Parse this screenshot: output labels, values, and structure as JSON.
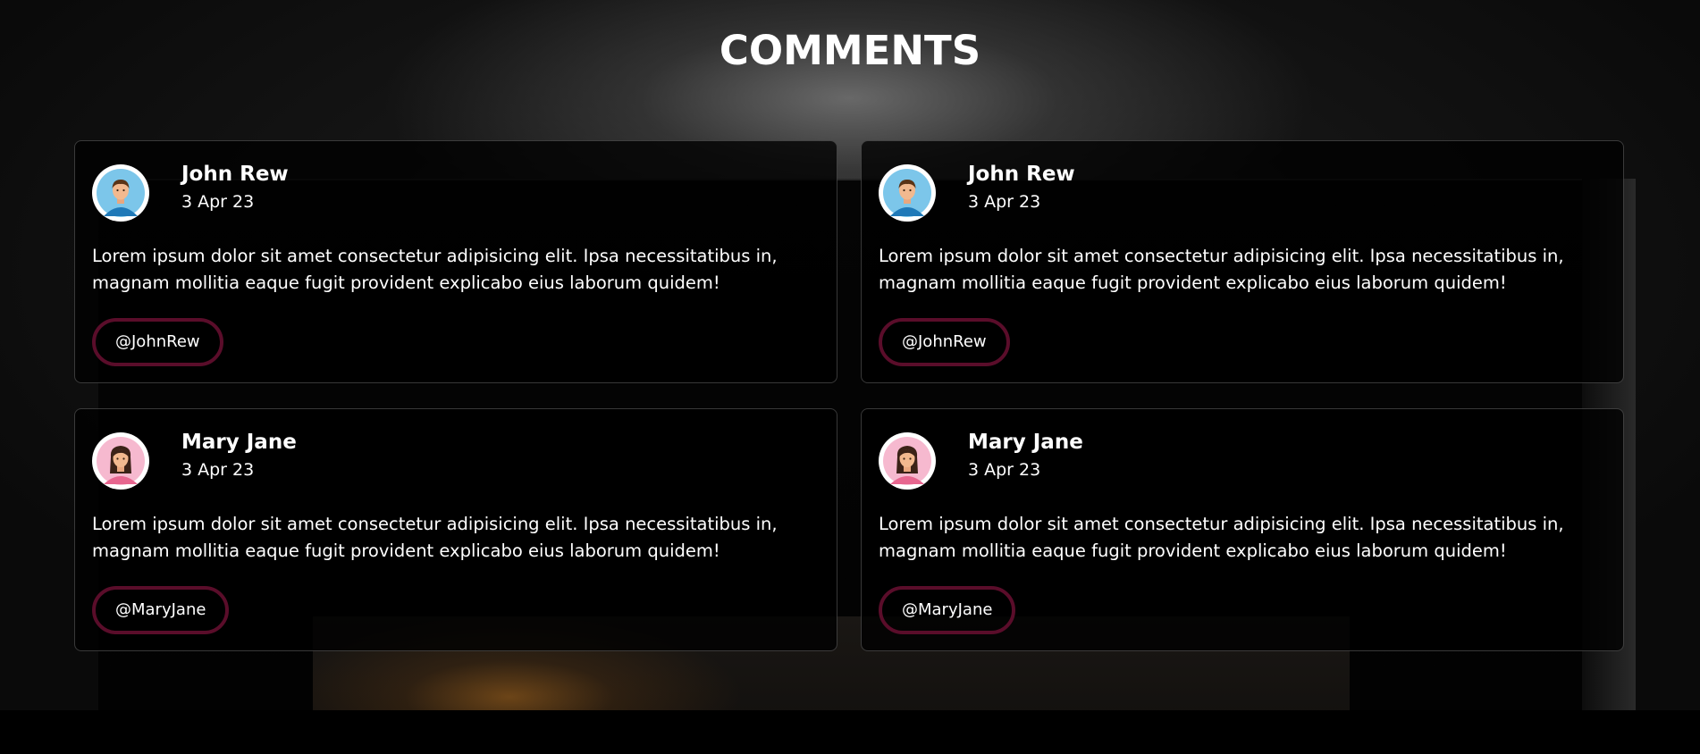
{
  "section": {
    "title": "COMMENTS"
  },
  "comments": [
    {
      "name": "John Rew",
      "date": "3 Apr 23",
      "text": "Lorem ipsum dolor sit amet consectetur adipisicing elit. Ipsa necessitatibus in, magnam mollitia eaque fugit provident explicabo eius laborum quidem!",
      "handle": "@JohnRew",
      "avatar": "male-user-avatar-icon"
    },
    {
      "name": "John Rew",
      "date": "3 Apr 23",
      "text": "Lorem ipsum dolor sit amet consectetur adipisicing elit. Ipsa necessitatibus in, magnam mollitia eaque fugit provident explicabo eius laborum quidem!",
      "handle": "@JohnRew",
      "avatar": "male-user-avatar-icon"
    },
    {
      "name": "Mary Jane",
      "date": "3 Apr 23",
      "text": "Lorem ipsum dolor sit amet consectetur adipisicing elit. Ipsa necessitatibus in, magnam mollitia eaque fugit provident explicabo eius laborum quidem!",
      "handle": "@MaryJane",
      "avatar": "female-user-avatar-icon"
    },
    {
      "name": "Mary Jane",
      "date": "3 Apr 23",
      "text": "Lorem ipsum dolor sit amet consectetur adipisicing elit. Ipsa necessitatibus in, magnam mollitia eaque fugit provident explicabo eius laborum quidem!",
      "handle": "@MaryJane",
      "avatar": "female-user-avatar-icon"
    }
  ],
  "colors": {
    "handle_border": "#5a0d2a",
    "text": "#ffffff",
    "card_border": "rgba(255,255,255,0.22)",
    "male_avatar_bg": "#7cc6ea",
    "female_avatar_bg": "#f6b9cf"
  }
}
